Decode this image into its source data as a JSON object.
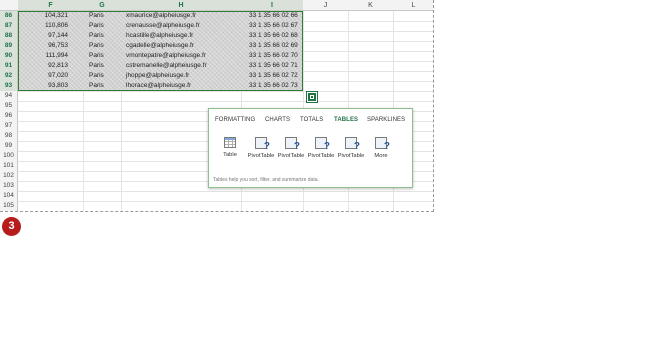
{
  "columns": [
    "F",
    "G",
    "H",
    "I",
    "J",
    "K",
    "L"
  ],
  "selected_columns": [
    "F",
    "G",
    "H",
    "I"
  ],
  "row_numbers": [
    "86",
    "87",
    "88",
    "89",
    "90",
    "91",
    "92",
    "93",
    "94",
    "95",
    "96",
    "97",
    "98",
    "99",
    "100",
    "101",
    "102",
    "103",
    "104",
    "105",
    "106"
  ],
  "selected_rows": [
    "86",
    "87",
    "88",
    "89",
    "90",
    "91",
    "92",
    "93"
  ],
  "data_rows": [
    {
      "f": "104,321",
      "g": "Paris",
      "h": "xmaurice@alpheiusge.fr",
      "i": "33 1 35 66 02 66"
    },
    {
      "f": "110,806",
      "g": "Paris",
      "h": "crenausse@alpheiusge.fr",
      "i": "33 1 35 66 02 67"
    },
    {
      "f": "97,144",
      "g": "Paris",
      "h": "hcastille@alpheiusge.fr",
      "i": "33 1 35 66 02 68"
    },
    {
      "f": "96,753",
      "g": "Paris",
      "h": "cgadelle@alpheiusge.fr",
      "i": "33 1 35 66 02 69"
    },
    {
      "f": "111,994",
      "g": "Paris",
      "h": "vmontepatre@alpheiusge.fr",
      "i": "33 1 35 66 02 70"
    },
    {
      "f": "92,813",
      "g": "Paris",
      "h": "cstremanelle@alpheiusge.fr",
      "i": "33 1 35 66 02 71"
    },
    {
      "f": "97,020",
      "g": "Paris",
      "h": "jhoppe@alpheiusge.fr",
      "i": "33 1 35 66 02 72"
    },
    {
      "f": "93,803",
      "g": "Paris",
      "h": "lhorace@alpheiusge.fr",
      "i": "33 1 35 66 02 73"
    }
  ],
  "quick_analysis": {
    "tabs": [
      "FORMATTING",
      "CHARTS",
      "TOTALS",
      "TABLES",
      "SPARKLINES"
    ],
    "active_tab": "TABLES",
    "options": [
      {
        "label": "Table",
        "icon": "table-icon"
      },
      {
        "label": "PivotTable",
        "icon": "pivot-table-icon"
      },
      {
        "label": "PivotTable",
        "icon": "pivot-table-icon"
      },
      {
        "label": "PivotTable",
        "icon": "pivot-table-icon"
      },
      {
        "label": "PivotTable",
        "icon": "pivot-table-icon"
      },
      {
        "label": "More",
        "icon": "more-pivot-icon"
      }
    ],
    "hint": "Tables help you sort, filter, and summarize data."
  },
  "step_badge": "3",
  "colors": {
    "accent": "#217346",
    "badge": "#b71c1c",
    "selection": "#d2d2d2"
  }
}
